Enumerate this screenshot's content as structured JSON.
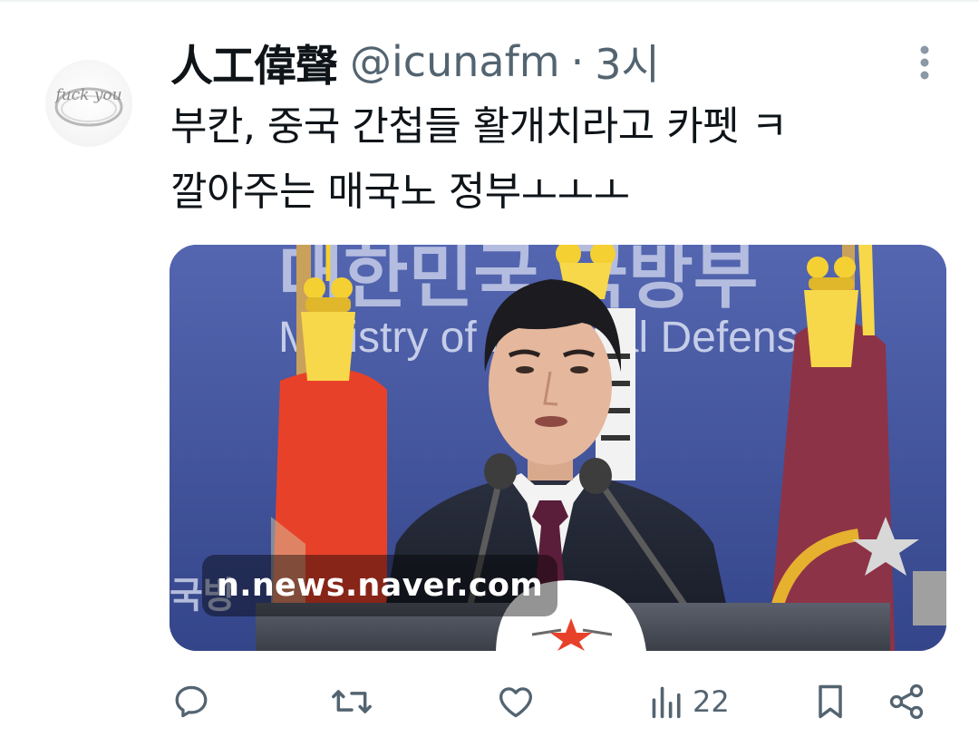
{
  "tweet": {
    "author": {
      "display_name": "人工偉聲",
      "handle": "@icunafm",
      "avatar_text": "fuck you"
    },
    "separator": "·",
    "time": "3시",
    "text_lines": [
      "부칸, 중국 간첩들 활개치라고 카펫 ㅋ",
      "깔아주는 매국노 정부ㅗㅗㅗ"
    ],
    "media": {
      "domain": "n.news.naver.com",
      "backdrop_text_korean": "대한민국 국방부",
      "backdrop_text_english": "Ministry of National Defense",
      "corner_text": "국방"
    },
    "actions": {
      "reply": {
        "icon": "reply-icon"
      },
      "retweet": {
        "icon": "retweet-icon"
      },
      "like": {
        "icon": "heart-icon"
      },
      "views": {
        "icon": "views-icon",
        "count": "22"
      },
      "bookmark": {
        "icon": "bookmark-icon"
      },
      "share": {
        "icon": "share-icon"
      }
    }
  },
  "colors": {
    "text": "#0f1419",
    "secondary": "#536471",
    "backdrop_blue": "#3c4f98",
    "flag_red": "#e8412a",
    "flag_maroon": "#8d3347",
    "tassel_gold": "#f5d033"
  }
}
